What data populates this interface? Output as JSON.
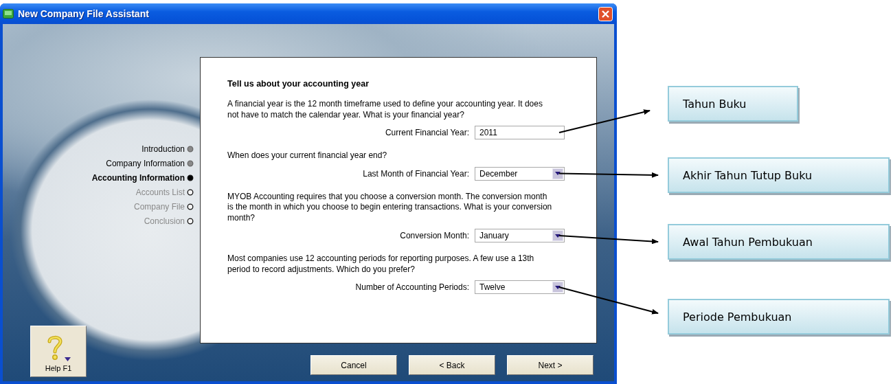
{
  "window": {
    "title": "New Company File Assistant"
  },
  "steps": [
    {
      "label": "Introduction",
      "completed": true,
      "selected": false
    },
    {
      "label": "Company Information",
      "completed": true,
      "selected": false
    },
    {
      "label": "Accounting Information",
      "completed": false,
      "selected": true
    },
    {
      "label": "Accounts List",
      "completed": false,
      "selected": false
    },
    {
      "label": "Company File",
      "completed": false,
      "selected": false
    },
    {
      "label": "Conclusion",
      "completed": false,
      "selected": false
    }
  ],
  "page": {
    "heading": "Tell us about your accounting year",
    "sections": [
      {
        "text": "A financial year is the 12 month timeframe used to define your accounting year.  It does not have to match the calendar year.  What is your financial year?",
        "field": {
          "kind": "text",
          "label": "Current Financial Year:",
          "value": "2011"
        }
      },
      {
        "text": "When does your current financial year end?",
        "field": {
          "kind": "dropdown",
          "label": "Last Month of Financial Year:",
          "value": "December"
        }
      },
      {
        "text": "MYOB Accounting requires that you choose a conversion month.  The conversion month is the month in which you choose to begin entering transactions.  What is your conversion month?",
        "field": {
          "kind": "dropdown",
          "label": "Conversion Month:",
          "value": "January"
        }
      },
      {
        "text": "Most companies use 12 accounting periods for reporting purposes.  A few use a 13th period to record adjustments.  Which do you prefer?",
        "field": {
          "kind": "dropdown",
          "label": "Number of Accounting Periods:",
          "value": "Twelve"
        }
      }
    ]
  },
  "help_button": {
    "label": "Help F1"
  },
  "buttons": [
    {
      "label": "Cancel"
    },
    {
      "label": "< Back"
    },
    {
      "label": "Next >"
    }
  ],
  "callouts": [
    {
      "text": "Tahun Buku"
    },
    {
      "text": "Akhir Tahun Tutup Buku"
    },
    {
      "text": "Awal Tahun Pembukuan"
    },
    {
      "text": "Periode Pembukuan"
    }
  ]
}
